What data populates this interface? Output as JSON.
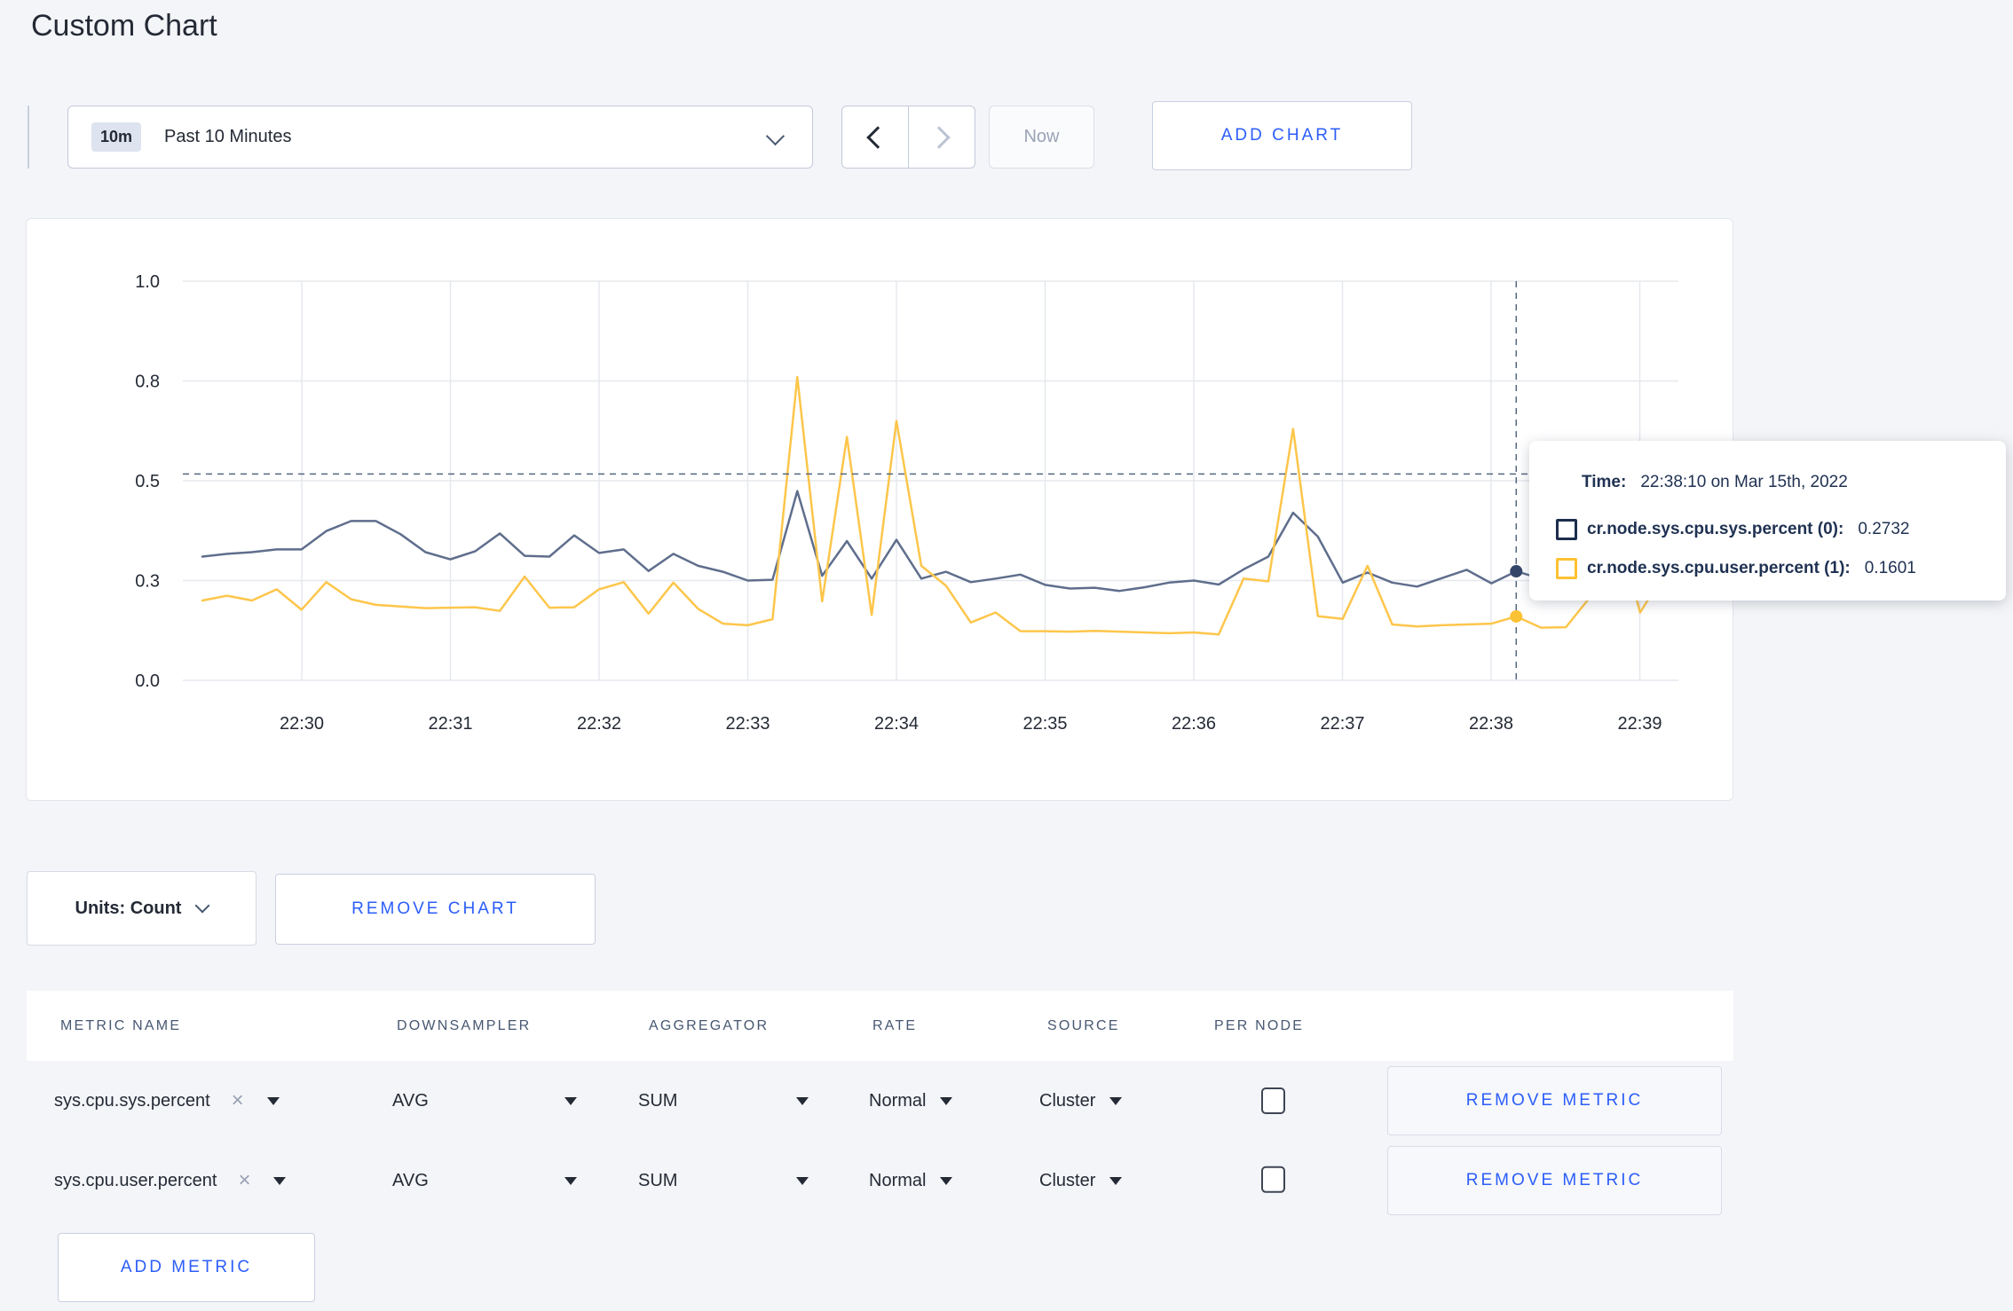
{
  "page": {
    "title": "Custom Chart",
    "background": "#f4f5f8",
    "accent_blue": "#2b5dfa"
  },
  "toolbar": {
    "timescale": {
      "badge": "10m",
      "label": "Past 10 Minutes"
    },
    "now_label": "Now",
    "add_chart_label": "ADD CHART"
  },
  "chart_data": {
    "type": "line",
    "title": "",
    "xlabel": "",
    "ylabel": "",
    "ylim": [
      0,
      1
    ],
    "grid": true,
    "legend_position": "tooltip",
    "x_start": "22:29:20",
    "x_step_seconds": 10,
    "x_ticks": [
      "22:30",
      "22:31",
      "22:32",
      "22:33",
      "22:34",
      "22:35",
      "22:36",
      "22:37",
      "22:38",
      "22:39"
    ],
    "y_tick_labels": [
      "0.0",
      "0.3",
      "0.5",
      "0.8",
      "1.0"
    ],
    "y_tick_values": [
      0,
      0.25,
      0.5,
      0.75,
      1
    ],
    "series": [
      {
        "name": "cr.node.sys.cpu.sys.percent (0)",
        "color": "#5f6e8c",
        "values": [
          0.31,
          0.317,
          0.321,
          0.328,
          0.328,
          0.374,
          0.399,
          0.399,
          0.366,
          0.321,
          0.303,
          0.323,
          0.368,
          0.312,
          0.31,
          0.363,
          0.319,
          0.328,
          0.274,
          0.317,
          0.287,
          0.272,
          0.25,
          0.252,
          0.474,
          0.262,
          0.349,
          0.255,
          0.352,
          0.255,
          0.272,
          0.246,
          0.255,
          0.265,
          0.239,
          0.23,
          0.232,
          0.224,
          0.233,
          0.245,
          0.25,
          0.24,
          0.278,
          0.31,
          0.42,
          0.36,
          0.245,
          0.27,
          0.245,
          0.235,
          0.256,
          0.277,
          0.243,
          0.2732,
          0.255,
          0.262,
          0.285,
          0.3,
          0.29,
          0.28
        ]
      },
      {
        "name": "cr.node.sys.cpu.user.percent (1)",
        "color": "#fdc64b",
        "values": [
          0.2,
          0.212,
          0.2,
          0.228,
          0.177,
          0.246,
          0.203,
          0.189,
          0.185,
          0.181,
          0.182,
          0.183,
          0.174,
          0.26,
          0.182,
          0.183,
          0.228,
          0.246,
          0.167,
          0.245,
          0.179,
          0.142,
          0.138,
          0.153,
          0.76,
          0.198,
          0.61,
          0.164,
          0.65,
          0.287,
          0.237,
          0.145,
          0.17,
          0.123,
          0.123,
          0.122,
          0.124,
          0.122,
          0.12,
          0.118,
          0.12,
          0.115,
          0.255,
          0.248,
          0.63,
          0.161,
          0.154,
          0.287,
          0.14,
          0.135,
          0.138,
          0.14,
          0.142,
          0.1601,
          0.132,
          0.133,
          0.21,
          0.4,
          0.17,
          0.27
        ]
      }
    ],
    "hover": {
      "index": 53,
      "time": "22:38:10",
      "pointer_value": 0.517,
      "dot_colors": [
        "#33466a",
        "#fcc235"
      ]
    }
  },
  "tooltip": {
    "time_label": "Time:",
    "time_value": "22:38:10 on Mar 15th, 2022",
    "rows": [
      {
        "label": "cr.node.sys.cpu.sys.percent (0):",
        "value": "0.2732",
        "swatch_color": "#1c2d4c"
      },
      {
        "label": "cr.node.sys.cpu.user.percent (1):",
        "value": "0.1601",
        "swatch_color": "#fdc132"
      }
    ]
  },
  "chart_controls": {
    "units_label": "Units: Count",
    "remove_chart_label": "REMOVE CHART"
  },
  "metrics_table": {
    "columns": [
      "METRIC NAME",
      "DOWNSAMPLER",
      "AGGREGATOR",
      "RATE",
      "SOURCE",
      "PER NODE"
    ],
    "rows": [
      {
        "metric_name": "sys.cpu.sys.percent",
        "close_icon": "×",
        "downsampler": "AVG",
        "aggregator": "SUM",
        "rate": "Normal",
        "source": "Cluster",
        "per_node_checked": false,
        "remove_label": "REMOVE METRIC"
      },
      {
        "metric_name": "sys.cpu.user.percent",
        "close_icon": "×",
        "downsampler": "AVG",
        "aggregator": "SUM",
        "rate": "Normal",
        "source": "Cluster",
        "per_node_checked": false,
        "remove_label": "REMOVE METRIC"
      }
    ],
    "add_metric_label": "ADD METRIC"
  }
}
